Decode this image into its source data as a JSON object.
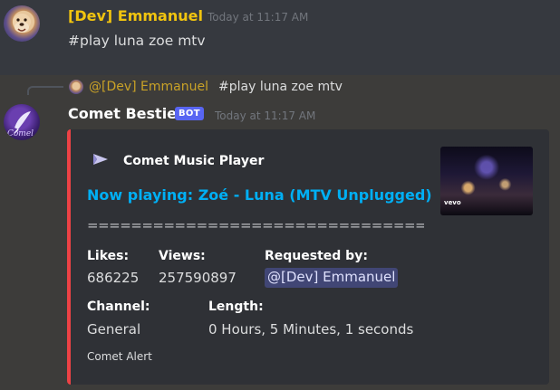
{
  "message1": {
    "author": "[Dev] Emmanuel",
    "author_color": "#f1c40f",
    "timestamp": "Today at 11:17 AM",
    "content": "#play luna zoe mtv"
  },
  "reply": {
    "mention": "@[Dev] Emmanuel",
    "text": "#play luna zoe mtv"
  },
  "message2": {
    "author": "Comet Bestie",
    "badge": "BOT",
    "timestamp": "Today at 11:17 AM"
  },
  "embed": {
    "accent_color": "#ed4245",
    "author_icon": "play-icon",
    "author_name": "Comet Music Player",
    "title": "Now playing: Zoé - Luna (MTV Unplugged)",
    "description": "==================================",
    "thumbnail_text": "vevo",
    "fields": {
      "likes": {
        "name": "Likes:",
        "value": "686225"
      },
      "views": {
        "name": "Views:",
        "value": "257590897"
      },
      "requested_by": {
        "name": "Requested by:",
        "value": "@[Dev] Emmanuel"
      },
      "channel": {
        "name": "Channel:",
        "value": "General"
      },
      "length": {
        "name": "Length:",
        "value": "0 Hours, 5 Minutes, 1 seconds"
      }
    },
    "footer": "Comet Alert"
  }
}
